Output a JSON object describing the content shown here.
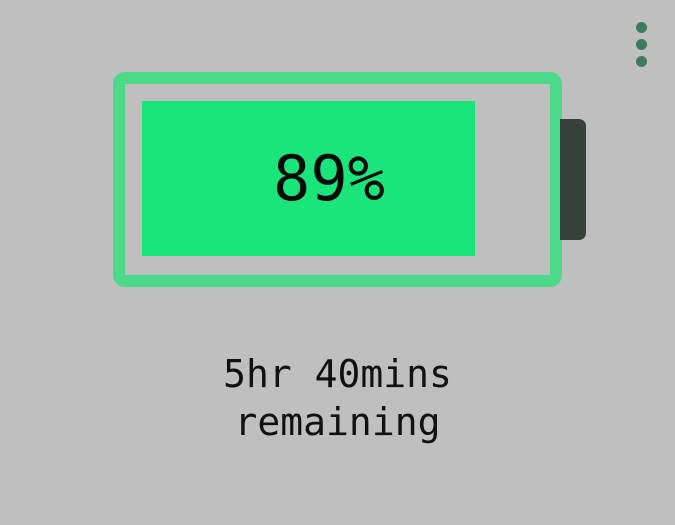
{
  "menu": {
    "icon": "more-vert-icon"
  },
  "battery": {
    "level": 0.89,
    "percent_label": "89%",
    "colors": {
      "outline": "#4cd98a",
      "fill": "#19e57a",
      "cap": "#35423a"
    }
  },
  "status": {
    "time_remaining": "5hr 40mins",
    "remaining_label": "remaining"
  },
  "colors": {
    "background": "#bfbfbf",
    "accent": "#3f7a5c"
  }
}
